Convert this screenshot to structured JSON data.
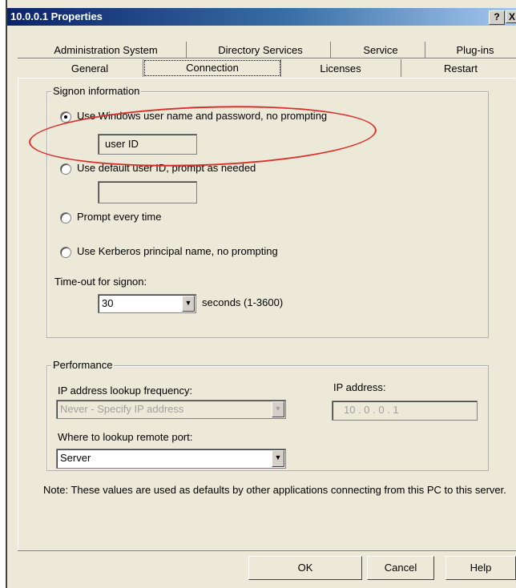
{
  "window": {
    "title": "10.0.0.1 Properties",
    "help_label": "?",
    "close_label": "X"
  },
  "tabs": {
    "row1": [
      "Administration System",
      "Directory Services",
      "Service",
      "Plug-ins"
    ],
    "row2": [
      "General",
      "Connection",
      "Licenses",
      "Restart"
    ],
    "active": "Connection"
  },
  "signon": {
    "legend": "Signon information",
    "options": [
      {
        "label": "Use Windows user name and password, no prompting",
        "checked": true
      },
      {
        "label": "Use default user ID, prompt as needed",
        "checked": false
      },
      {
        "label": "Prompt every time",
        "checked": false
      },
      {
        "label": "Use Kerberos principal name, no prompting",
        "checked": false
      }
    ],
    "user_id_value": "user ID",
    "default_user_id_value": "",
    "timeout_label": "Time-out for signon:",
    "timeout_value": "30",
    "timeout_units": "seconds (1-3600)"
  },
  "performance": {
    "legend": "Performance",
    "lookup_freq_label": "IP address lookup frequency:",
    "lookup_freq_value": "Never - Specify IP address",
    "ip_label": "IP address:",
    "ip_value": "10 . 0 . 0 . 1",
    "remote_port_label": "Where to lookup remote port:",
    "remote_port_value": "Server"
  },
  "note": "Note: These values are used as defaults by other applications connecting from this PC to this server.",
  "buttons": {
    "ok": "OK",
    "cancel": "Cancel",
    "help": "Help"
  },
  "colors": {
    "dialog_bg": "#ece9d8",
    "titlebar": "#0a246a",
    "annotation": "#d9302c"
  }
}
